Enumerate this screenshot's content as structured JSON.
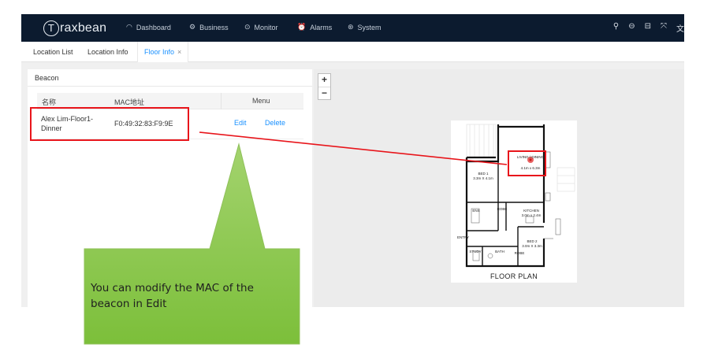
{
  "app": {
    "logo_mark": "T",
    "logo_text": "raxbean"
  },
  "nav": [
    {
      "label": "Dashboard",
      "icon": "gauge-icon",
      "glyph": "◠"
    },
    {
      "label": "Business",
      "icon": "gears-icon",
      "glyph": "⚙"
    },
    {
      "label": "Monitor",
      "icon": "location-pin-icon",
      "glyph": "⊙"
    },
    {
      "label": "Alarms",
      "icon": "alarm-icon",
      "glyph": "⏰"
    },
    {
      "label": "System",
      "icon": "settings-icon",
      "glyph": "⊛"
    }
  ],
  "toolbar": {
    "search_glyph": "⚲",
    "message_glyph": "⊖",
    "lock_glyph": "⊟",
    "fullscreen_glyph": "⤧",
    "language_glyph": "文"
  },
  "tabs": [
    {
      "label": "Location List"
    },
    {
      "label": "Location Info"
    },
    {
      "label": "Floor Info",
      "close": "×"
    }
  ],
  "beacon_panel": {
    "title": "Beacon",
    "columns": {
      "name": "名称",
      "mac": "MAC地址",
      "menu": "Menu"
    },
    "rows": [
      {
        "name": "Alex Lim-Floor1-Dinner",
        "mac": "F0:49:32:83:F9:9E",
        "edit": "Edit",
        "delete": "Delete"
      }
    ]
  },
  "map": {
    "zoom_in": "+",
    "zoom_out": "−",
    "floor_plan": {
      "caption": "FLOOR PLAN",
      "rooms": {
        "living": "LIVING / DINING",
        "living_size": "4.1m x 6.3m",
        "bed1": "BED 1",
        "bed1_size": "3.3m X 4.1m",
        "kitchen": "KITCHEN",
        "kitchen_size": "3.0m x 2.4m",
        "bed2": "BED 2",
        "bed2_size": "3.0m X 3.3m",
        "ens": "ENS",
        "bath": "BATH",
        "study": "STUDY",
        "robe1": "ROBE",
        "robe2": "ROBE",
        "entry": "ENTRY"
      }
    }
  },
  "annotation": {
    "text": "You can modify the MAC of the beacon in Edit",
    "callout_color": "#8cc63e",
    "highlight_color": "#e8151b"
  }
}
